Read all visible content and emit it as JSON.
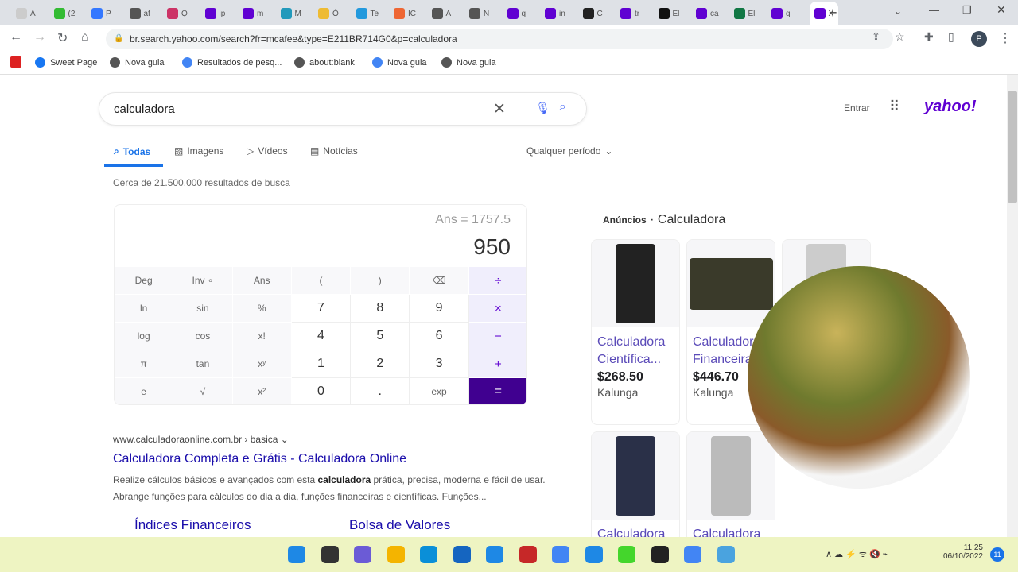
{
  "browser": {
    "tabs": [
      "A",
      "(2",
      "P",
      "af",
      "Q",
      "ip",
      "m",
      "M",
      "Ó",
      "Te",
      "IC",
      "A",
      "N",
      "q",
      "in",
      "C",
      "tr",
      "El",
      "ca",
      "El",
      "q",
      "X"
    ],
    "url": "br.search.yahoo.com/search?fr=mcafee&type=E211BR714G0&p=calculadora",
    "profile": "P",
    "bookmarks": [
      "Sweet Page",
      "Nova guia",
      "Resultados de pesq...",
      "about:blank",
      "Nova guia",
      "Nova guia"
    ]
  },
  "search": {
    "query": "calculadora",
    "signin": "Entrar",
    "logo": "yahoo!"
  },
  "vtabs": [
    "Todas",
    "Imagens",
    "Vídeos",
    "Notícias"
  ],
  "period": "Qualquer período",
  "results_count": "Cerca de 21.500.000 resultados de busca",
  "calculator": {
    "ans": "Ans = 1757.5",
    "display": "950",
    "keys": [
      "Deg",
      "Inv ∘",
      "Ans",
      "(",
      ")",
      "⌫",
      "÷",
      "ln",
      "sin",
      "%",
      "7",
      "8",
      "9",
      "×",
      "log",
      "cos",
      "x!",
      "4",
      "5",
      "6",
      "−",
      "π",
      "tan",
      "xʸ",
      "1",
      "2",
      "3",
      "+",
      "e",
      "√",
      "x²",
      "0",
      ".",
      "exp",
      "="
    ]
  },
  "result": {
    "url": "www.calculadoraonline.com.br › basica",
    "title": "Calculadora Completa e Grátis - Calculadora Online",
    "snippet_pre": "Realize cálculos básicos e avançados com esta ",
    "snippet_bold": "calculadora",
    "snippet_post": " prática, precisa, moderna e fácil de usar. Abrange funções para cálculos do dia a dia, funções financeiras e científicas. Funções...",
    "sitelinks": [
      "Índices Financeiros",
      "Bolsa de Valores"
    ]
  },
  "ads": {
    "label": "Anúncios",
    "title": "Calculadora",
    "items": [
      {
        "title": "Calculadora Científica...",
        "price": "$268.50",
        "store": "Kalunga"
      },
      {
        "title": "Calculadora Financeira",
        "price": "$446.70",
        "store": "Kalunga"
      },
      {
        "title": "Calculadora"
      },
      {
        "title": "Calculadora"
      },
      {
        "title": "Calculadora"
      }
    ]
  },
  "taskbar": {
    "time": "11:25",
    "date": "06/10/2022",
    "notifications": "11"
  }
}
